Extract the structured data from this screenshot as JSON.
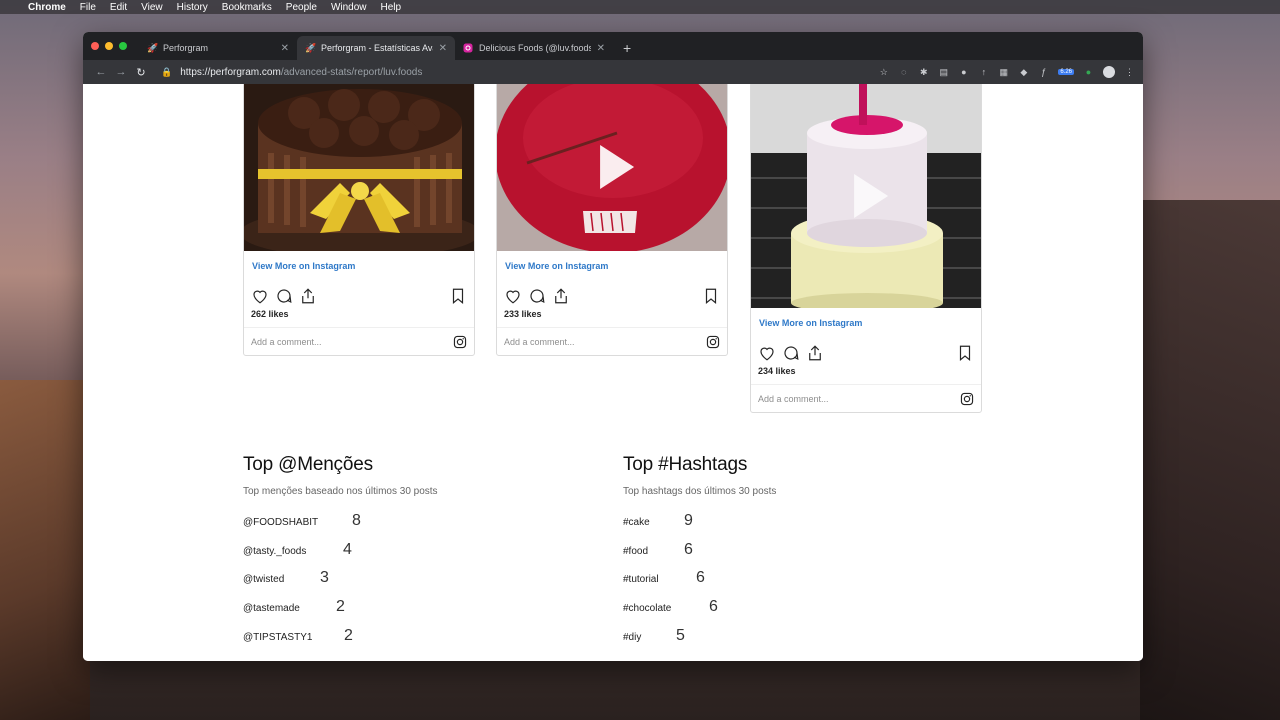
{
  "menubar": {
    "items": [
      "Chrome",
      "File",
      "Edit",
      "View",
      "History",
      "Bookmarks",
      "People",
      "Window",
      "Help"
    ]
  },
  "browser": {
    "tabs": [
      {
        "title": "Perforgram",
        "active": false
      },
      {
        "title": "Perforgram - Estatísticas Avan",
        "active": true
      },
      {
        "title": "Delicious Foods (@luv.foods) ·",
        "active": false
      }
    ],
    "url_host": "https://perforgram.com",
    "url_path": "/advanced-stats/report/luv.foods",
    "ext_badge": "6.26"
  },
  "posts": [
    {
      "view_more": "View More on Instagram",
      "likes": "262 likes",
      "comment_placeholder": "Add a comment...",
      "video": false
    },
    {
      "view_more": "View More on Instagram",
      "likes": "233 likes",
      "comment_placeholder": "Add a comment...",
      "video": true
    },
    {
      "view_more": "View More on Instagram",
      "likes": "234 likes",
      "comment_placeholder": "Add a comment...",
      "video": true
    }
  ],
  "mentions": {
    "title": "Top @Menções",
    "subtitle": "Top menções baseado nos últimos 30 posts",
    "rows": [
      {
        "tag": "@FOODSHABIT",
        "count": "8"
      },
      {
        "tag": "@tasty._foods",
        "count": "4"
      },
      {
        "tag": "@twisted",
        "count": "3"
      },
      {
        "tag": "@tastemade",
        "count": "2"
      },
      {
        "tag": "@TIPSTASTY1",
        "count": "2"
      }
    ]
  },
  "hashtags": {
    "title": "Top #Hashtags",
    "subtitle": "Top hashtags dos últimos 30 posts",
    "rows": [
      {
        "tag": "#cake",
        "count": "9"
      },
      {
        "tag": "#food",
        "count": "6"
      },
      {
        "tag": "#tutorial",
        "count": "6"
      },
      {
        "tag": "#chocolate",
        "count": "6"
      },
      {
        "tag": "#diy",
        "count": "5"
      }
    ]
  }
}
